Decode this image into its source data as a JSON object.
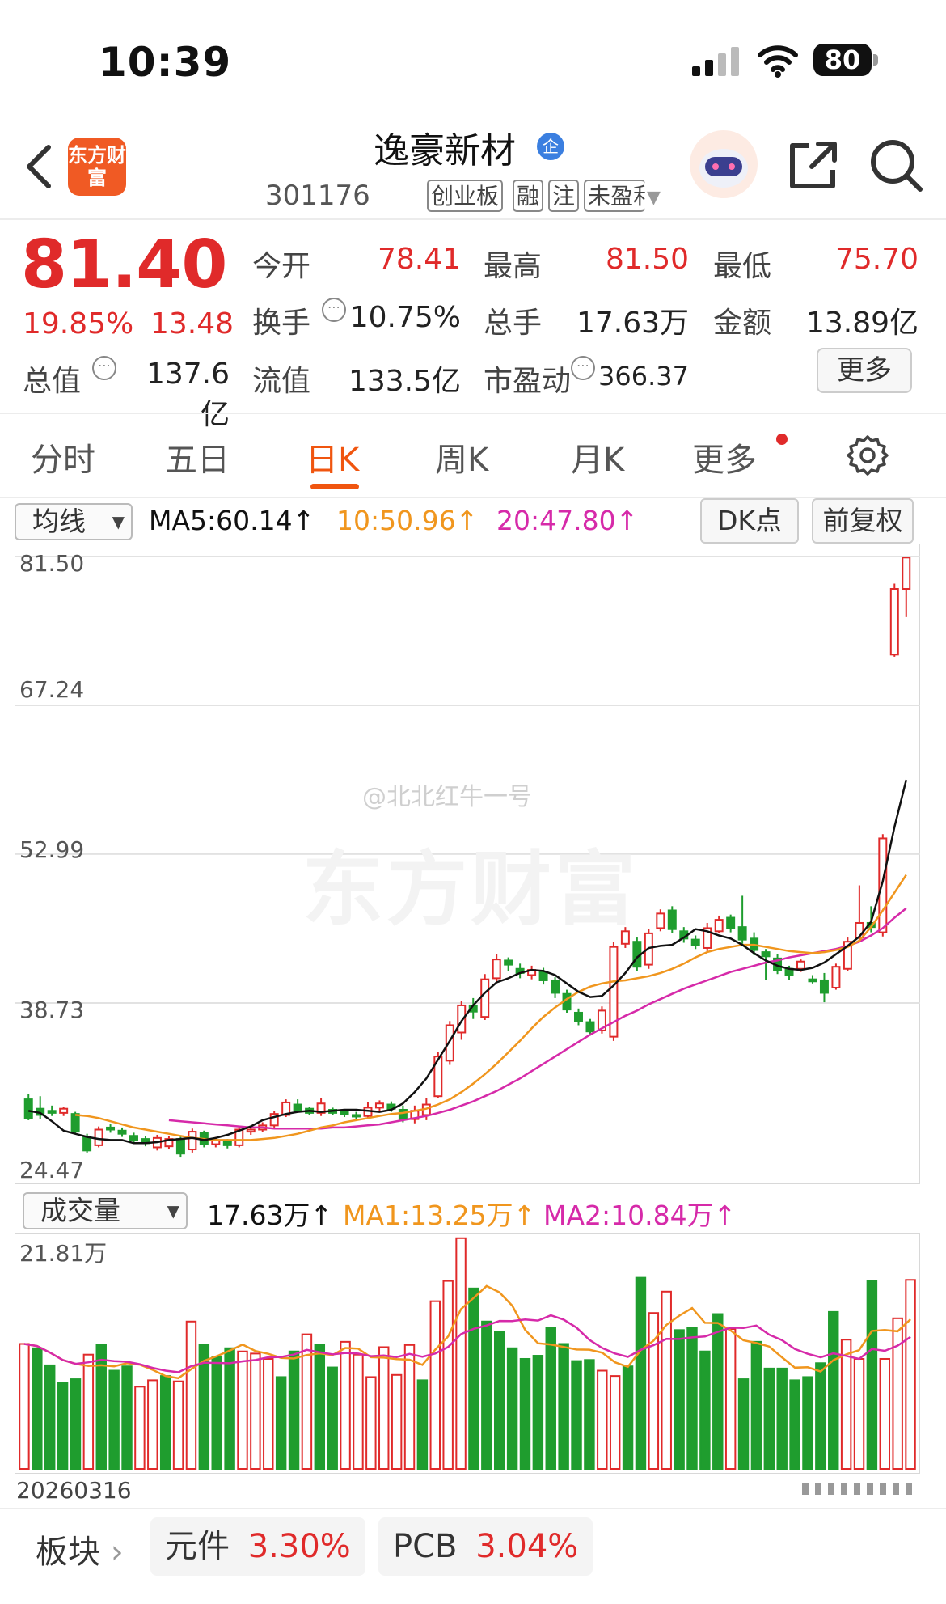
{
  "status_bar": {
    "time": "10:39",
    "battery": "80"
  },
  "header": {
    "app_logo_text": "东方财富",
    "stock_name": "逸豪新材",
    "enterprise_badge": "企",
    "stock_code": "301176",
    "tags": [
      "创业板",
      "融",
      "注",
      "未盈利"
    ]
  },
  "quote": {
    "price": "81.40",
    "change_pct": "19.85%",
    "change_amt": "13.48",
    "fields": [
      {
        "label": "今开",
        "value": "78.41",
        "color": "red"
      },
      {
        "label": "最高",
        "value": "81.50",
        "color": "red"
      },
      {
        "label": "最低",
        "value": "75.70",
        "color": "red"
      },
      {
        "label": "换手",
        "value": "10.75%",
        "color": "black"
      },
      {
        "label": "总手",
        "value": "17.63万",
        "color": "black"
      },
      {
        "label": "金额",
        "value": "13.89亿",
        "color": "black"
      },
      {
        "label": "总值",
        "value": "137.6亿",
        "color": "black"
      },
      {
        "label": "流值",
        "value": "133.5亿",
        "color": "black"
      },
      {
        "label": "市盈动",
        "value": "366.37",
        "color": "black"
      }
    ],
    "more_label": "更多"
  },
  "tabs": [
    "分时",
    "五日",
    "日K",
    "周K",
    "月K",
    "更多"
  ],
  "active_tab": 2,
  "ma_row": {
    "dropdown_label": "均线",
    "ma5": "MA5:60.14↑",
    "ma10": "10:50.96↑",
    "ma20": "20:47.80↑",
    "dk_label": "DK点",
    "adjust_label": "前复权"
  },
  "volume_row": {
    "dropdown_label": "成交量",
    "vol": "17.63万↑",
    "ma1": "MA1:13.25万↑",
    "ma2": "MA2:10.84万↑"
  },
  "watermark": {
    "handle": "@北北红牛一号",
    "brand": "东方财富"
  },
  "colors": {
    "up": "#e02a2a",
    "down": "#1f9d2e",
    "ma5": "#111111",
    "ma10": "#f0961e",
    "ma20": "#d62aa9",
    "accent": "#f0550f"
  },
  "chart_data": {
    "type": "candlestick",
    "y_ticks": [
      "81.50",
      "67.24",
      "52.99",
      "38.73",
      "24.47"
    ],
    "ylim": [
      24.47,
      81.5
    ],
    "candles": [
      [
        29.5,
        27.7,
        30.0,
        27.5
      ],
      [
        28.6,
        28.0,
        29.8,
        27.6
      ],
      [
        28.4,
        28.2,
        28.9,
        27.9
      ],
      [
        28.2,
        28.6,
        28.8,
        27.9
      ],
      [
        28.1,
        26.4,
        28.3,
        26.2
      ],
      [
        25.9,
        24.6,
        26.2,
        24.4
      ],
      [
        25.1,
        26.6,
        26.9,
        24.9
      ],
      [
        26.8,
        26.6,
        27.1,
        26.3
      ],
      [
        26.5,
        26.2,
        26.8,
        25.9
      ],
      [
        26.0,
        25.6,
        26.3,
        25.3
      ],
      [
        25.7,
        25.3,
        26.0,
        25.0
      ],
      [
        24.9,
        25.8,
        26.1,
        24.6
      ],
      [
        25.0,
        25.7,
        26.0,
        24.7
      ],
      [
        25.7,
        24.3,
        25.9,
        24.0
      ],
      [
        24.7,
        26.4,
        26.7,
        24.4
      ],
      [
        26.3,
        25.2,
        26.5,
        24.9
      ],
      [
        25.2,
        25.6,
        25.9,
        24.9
      ],
      [
        25.5,
        25.1,
        25.7,
        24.8
      ],
      [
        25.1,
        26.6,
        26.9,
        24.9
      ],
      [
        26.4,
        26.6,
        26.9,
        26.1
      ],
      [
        26.6,
        27.0,
        27.3,
        26.4
      ],
      [
        27.0,
        28.1,
        28.4,
        26.8
      ],
      [
        28.0,
        29.2,
        29.5,
        27.8
      ],
      [
        29.0,
        28.5,
        29.5,
        28.3
      ],
      [
        28.6,
        28.2,
        28.8,
        28.0
      ],
      [
        28.2,
        29.1,
        29.6,
        27.9
      ],
      [
        28.5,
        28.2,
        28.7,
        28.0
      ],
      [
        28.3,
        28.1,
        28.5,
        27.8
      ],
      [
        28.0,
        27.9,
        28.3,
        27.6
      ],
      [
        27.9,
        28.7,
        29.2,
        27.6
      ],
      [
        28.7,
        29.1,
        29.4,
        28.4
      ],
      [
        29.0,
        28.6,
        29.3,
        28.3
      ],
      [
        28.5,
        27.6,
        28.9,
        27.3
      ],
      [
        27.6,
        28.4,
        28.9,
        27.2
      ],
      [
        28.0,
        29.0,
        29.6,
        27.5
      ],
      [
        29.8,
        33.6,
        34.0,
        29.6
      ],
      [
        33.2,
        36.6,
        37.0,
        32.8
      ],
      [
        35.9,
        38.5,
        38.9,
        35.2
      ],
      [
        38.5,
        37.9,
        39.2,
        37.2
      ],
      [
        37.4,
        41.0,
        41.5,
        37.1
      ],
      [
        41.1,
        42.9,
        43.4,
        40.8
      ],
      [
        42.8,
        42.4,
        43.1,
        41.8
      ],
      [
        42.0,
        41.6,
        42.5,
        41.1
      ],
      [
        41.4,
        41.9,
        42.3,
        41.0
      ],
      [
        41.7,
        40.9,
        42.1,
        40.5
      ],
      [
        40.9,
        39.7,
        41.2,
        39.2
      ],
      [
        39.6,
        38.1,
        40.0,
        37.8
      ],
      [
        37.8,
        37.0,
        38.2,
        36.6
      ],
      [
        36.9,
        36.0,
        37.2,
        35.6
      ],
      [
        36.1,
        38.0,
        38.4,
        35.8
      ],
      [
        35.5,
        44.1,
        44.6,
        35.1
      ],
      [
        44.4,
        45.6,
        46.0,
        44.0
      ],
      [
        44.6,
        42.2,
        45.0,
        41.8
      ],
      [
        42.4,
        45.4,
        45.8,
        42.0
      ],
      [
        45.9,
        47.3,
        47.7,
        45.6
      ],
      [
        47.6,
        45.8,
        48.0,
        45.4
      ],
      [
        45.6,
        44.9,
        46.0,
        44.5
      ],
      [
        44.8,
        44.3,
        45.2,
        43.9
      ],
      [
        44.0,
        45.9,
        46.4,
        43.7
      ],
      [
        45.6,
        46.7,
        47.1,
        45.4
      ],
      [
        46.9,
        45.9,
        47.2,
        45.5
      ],
      [
        46.0,
        44.8,
        49.0,
        44.4
      ],
      [
        44.9,
        43.8,
        45.5,
        43.3
      ],
      [
        43.6,
        43.2,
        43.9,
        40.9
      ],
      [
        43.0,
        41.9,
        43.4,
        41.5
      ],
      [
        42.0,
        41.4,
        42.3,
        40.9
      ],
      [
        42.0,
        42.7,
        42.9,
        41.7
      ],
      [
        41.0,
        40.8,
        41.4,
        40.6
      ],
      [
        40.9,
        39.7,
        41.6,
        38.8
      ],
      [
        40.2,
        42.2,
        42.5,
        40.0
      ],
      [
        42.0,
        44.6,
        45.0,
        41.8
      ],
      [
        45.0,
        46.4,
        50.0,
        44.6
      ],
      [
        46.4,
        46.0,
        48.0,
        45.5
      ],
      [
        45.5,
        54.5,
        54.9,
        45.1
      ],
      [
        72.1,
        78.4,
        78.9,
        71.9
      ],
      [
        78.4,
        81.4,
        81.5,
        75.7
      ]
    ],
    "ma5": [
      28.4,
      28.2,
      27.4,
      26.5,
      26.2,
      25.9,
      25.7,
      25.6,
      25.6,
      25.3,
      25.3,
      25.4,
      25.6,
      25.7,
      25.8,
      25.6,
      25.8,
      26.1,
      26.5,
      26.9,
      27.5,
      27.8,
      28.1,
      28.3,
      28.4,
      28.3,
      28.4,
      28.5,
      28.5,
      28.4,
      28.3,
      28.5,
      29.1,
      30.2,
      31.5,
      33.3,
      35.1,
      37.0,
      38.5,
      39.7,
      40.7,
      41.1,
      41.6,
      41.9,
      41.8,
      41.4,
      40.6,
      39.8,
      39.3,
      39.4,
      40.4,
      41.6,
      43.1,
      44.0,
      44.2,
      44.3,
      45.0,
      45.8,
      45.6,
      45.2,
      44.9,
      44.3,
      43.5,
      42.8,
      42.3,
      42.0,
      41.9,
      42.1,
      42.6,
      43.4,
      44.2,
      45.1,
      46.5,
      50.4,
      55.6,
      60.1
    ],
    "ma10": [
      28.0,
      27.9,
      27.7,
      27.4,
      27.1,
      26.8,
      26.6,
      26.4,
      26.2,
      26.0,
      25.8,
      25.7,
      25.6,
      25.6,
      25.6,
      25.6,
      25.7,
      25.8,
      26.0,
      26.2,
      26.5,
      26.8,
      27.0,
      27.3,
      27.5,
      27.7,
      27.9,
      28.1,
      28.2,
      28.4,
      28.6,
      29.0,
      29.5,
      30.2,
      31.0,
      31.9,
      32.9,
      34.0,
      35.1,
      36.3,
      37.4,
      38.3,
      39.1,
      39.8,
      40.3,
      40.6,
      40.8,
      40.9,
      41.1,
      41.3,
      41.6,
      42.0,
      42.5,
      43.1,
      43.6,
      43.9,
      44.1,
      44.3,
      44.3,
      44.1,
      43.9,
      43.7,
      43.6,
      43.5,
      43.6,
      43.8,
      44.1,
      44.7,
      46.0,
      47.6,
      49.3,
      51.0
    ],
    "ma20": [
      27.5,
      27.4,
      27.3,
      27.2,
      27.1,
      27.0,
      26.9,
      26.8,
      26.8,
      26.7,
      26.7,
      26.7,
      26.7,
      26.7,
      26.8,
      26.8,
      26.9,
      27.0,
      27.1,
      27.3,
      27.5,
      27.7,
      27.9,
      28.2,
      28.5,
      28.9,
      29.3,
      29.8,
      30.3,
      30.9,
      31.5,
      32.2,
      32.9,
      33.6,
      34.3,
      35.0,
      35.7,
      36.3,
      36.9,
      37.5,
      38.0,
      38.6,
      39.1,
      39.6,
      40.1,
      40.5,
      40.9,
      41.3,
      41.7,
      42.0,
      42.3,
      42.6,
      42.8,
      43.1,
      43.3,
      43.5,
      43.7,
      43.9,
      44.2,
      44.6,
      45.2,
      45.9,
      46.9,
      47.8
    ],
    "volume": {
      "ymax_label": "21.81万",
      "ymax": 21.81,
      "bars": [
        11.7,
        11.3,
        9.7,
        8.1,
        8.4,
        10.7,
        11.6,
        9.2,
        9.6,
        7.7,
        8.3,
        8.7,
        8.2,
        13.8,
        11.6,
        10.5,
        11.3,
        11.0,
        10.8,
        10.3,
        8.6,
        11.0,
        12.6,
        11.6,
        9.5,
        11.9,
        10.7,
        8.6,
        11.4,
        8.8,
        11.6,
        8.3,
        15.7,
        17.6,
        21.6,
        16.9,
        13.8,
        12.8,
        11.3,
        10.3,
        10.6,
        13.2,
        11.7,
        10.1,
        10.2,
        9.2,
        8.7,
        9.6,
        17.9,
        14.6,
        16.6,
        13.0,
        13.2,
        11.0,
        14.5,
        13.1,
        8.4,
        11.9,
        9.4,
        9.4,
        8.3,
        8.6,
        9.9,
        14.7,
        12.1,
        10.3,
        17.6,
        10.3,
        14.1,
        17.7
      ],
      "up": [
        1,
        0,
        0,
        0,
        0,
        1,
        0,
        0,
        0,
        1,
        1,
        0,
        1,
        1,
        0,
        0,
        0,
        1,
        1,
        1,
        0,
        0,
        1,
        0,
        0,
        1,
        1,
        1,
        1,
        1,
        1,
        0,
        1,
        1,
        1,
        0,
        0,
        0,
        0,
        0,
        0,
        0,
        0,
        0,
        0,
        1,
        1,
        0,
        0,
        1,
        1,
        0,
        0,
        0,
        0,
        1,
        0,
        0,
        0,
        0,
        0,
        0,
        0,
        0,
        1,
        1,
        0,
        1,
        1,
        1
      ],
      "ma1_label": "MA1",
      "ma2_label": "MA2"
    }
  },
  "volume_date": "20260316",
  "bottom_bar": {
    "sector_label": "板块",
    "chips": [
      {
        "name": "元件",
        "value": "3.30%"
      },
      {
        "name": "PCB",
        "value": "3.04%"
      }
    ]
  }
}
